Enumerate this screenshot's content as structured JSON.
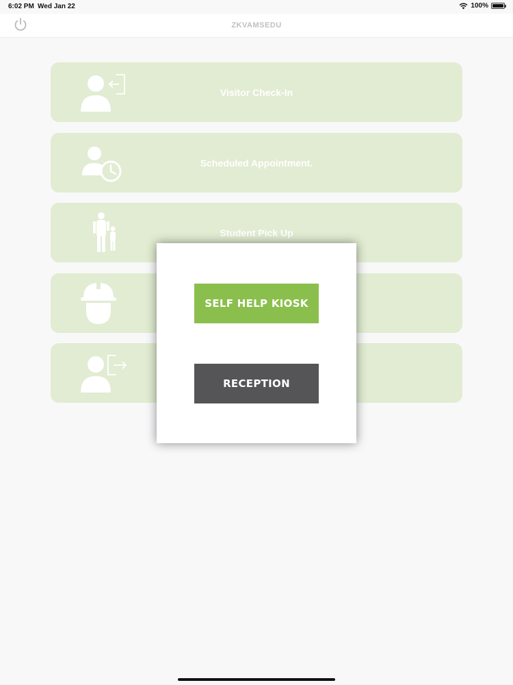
{
  "status_bar": {
    "time": "6:02 PM",
    "date": "Wed Jan 22",
    "battery": "100%"
  },
  "nav": {
    "title": "ZKVAMSEDU",
    "power_icon": "power-icon"
  },
  "menu": {
    "items": [
      {
        "label": "Visitor Check-In",
        "icon": "visitor-checkin-icon"
      },
      {
        "label": "Scheduled Appointment.",
        "icon": "scheduled-appointment-icon"
      },
      {
        "label": "Student Pick Up",
        "icon": "student-pickup-icon"
      },
      {
        "label": "",
        "icon": "contractor-helmet-icon"
      },
      {
        "label": "",
        "icon": "visitor-checkout-icon"
      }
    ],
    "tile_color": "#e1ecd2"
  },
  "modal": {
    "kiosk_label": "SELF HELP KIOSK",
    "reception_label": "RECEPTION",
    "kiosk_color": "#8bbf4d",
    "reception_color": "#555457"
  }
}
